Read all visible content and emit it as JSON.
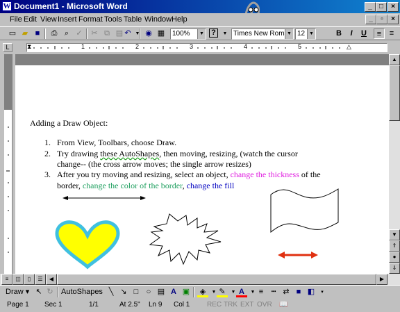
{
  "window": {
    "title": "Document1 - Microsoft Word"
  },
  "menu": [
    "File",
    "Edit",
    "View",
    "Insert",
    "Format",
    "Tools",
    "Table",
    "Window",
    "Help"
  ],
  "toolbar": {
    "zoom": "100%",
    "font": "Times New Roman",
    "size": "12",
    "bold": "B",
    "italic": "I",
    "underline": "U"
  },
  "ruler": {
    "numbers": [
      "1",
      "2",
      "3",
      "4",
      "5"
    ]
  },
  "document": {
    "heading": "Adding a Draw Object:",
    "items": [
      {
        "num": "1.",
        "text": "From View, Toolbars, choose Draw."
      },
      {
        "num": "2.",
        "line1a": " Try drawing ",
        "line1b": "these  AutoShapes",
        "line1c": ", then moving, resizing,  (watch the cursor",
        "line2": "change--  (the cross arrow moves; the single arrow resizes)"
      },
      {
        "num": "3.",
        "line1a": "After you try moving and resizing, select an object, ",
        "line1b": "change the thickness",
        "line1c": " of the",
        "line2a": "border, ",
        "line2b": "change the color of the border",
        "line2c": ", ",
        "line2d": "change the fill"
      }
    ]
  },
  "drawbar": {
    "draw": "Draw",
    "autoshapes": "AutoShapes"
  },
  "status": {
    "page": "Page 1",
    "sec": "Sec 1",
    "pages": "1/1",
    "at": "At  2.5\"",
    "ln": "Ln  9",
    "col": "Col  1",
    "rec": "REC",
    "trk": "TRK",
    "ext": "EXT",
    "ovr": "OVR"
  },
  "colors": {
    "heart_fill": "#ffff00",
    "heart_border": "#40c0e0",
    "arrow_red": "#e03010",
    "title_left": "#000080",
    "title_right": "#1084d0"
  }
}
